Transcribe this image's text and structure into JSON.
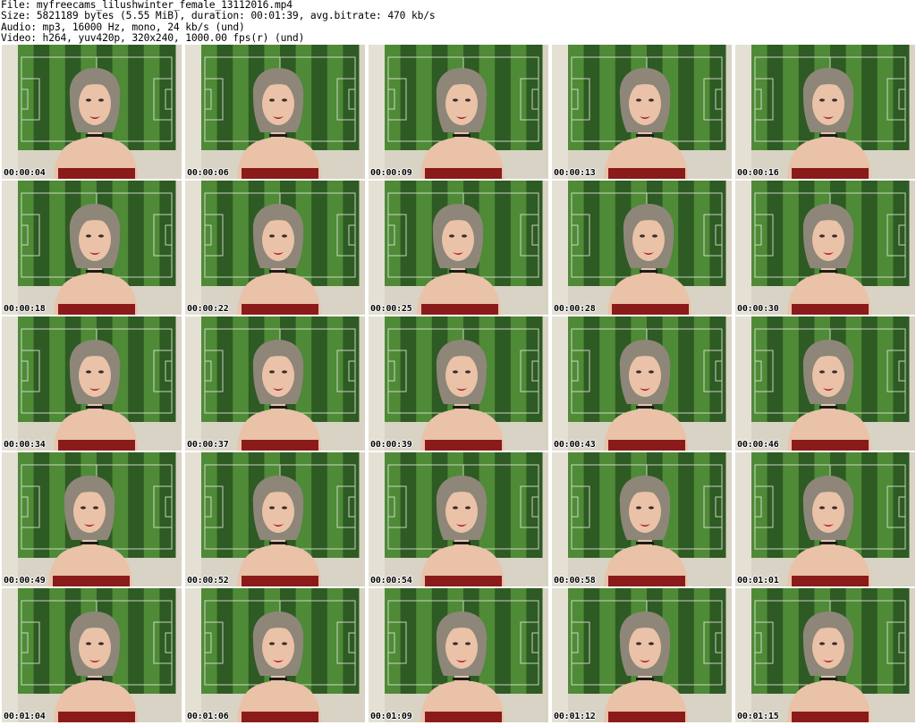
{
  "header": {
    "file_line": "File: myfreecams_lilushwinter_female_13112016.mp4",
    "size_line": "Size: 5821189 bytes (5.55 MiB), duration: 00:01:39, avg.bitrate: 470 kb/s",
    "audio_line": "Audio: mp3, 16000 Hz, mono, 24 kb/s (und)",
    "video_line": "Video: h264, yuv420p, 320x240, 1000.00 fps(r) (und)"
  },
  "frames": [
    "00:00:04",
    "00:00:06",
    "00:00:09",
    "00:00:13",
    "00:00:16",
    "00:00:18",
    "00:00:22",
    "00:00:25",
    "00:00:28",
    "00:00:30",
    "00:00:34",
    "00:00:37",
    "00:00:39",
    "00:00:43",
    "00:00:46",
    "00:00:49",
    "00:00:52",
    "00:00:54",
    "00:00:58",
    "00:01:01",
    "00:01:04",
    "00:01:06",
    "00:01:09",
    "00:01:12",
    "00:01:15"
  ],
  "colors": {
    "wall": "#d8d3c4",
    "field_light": "#4f8a37",
    "field_dark": "#2e5a23",
    "hair": "#8e8678",
    "skin": "#e9c2a8",
    "top": "#8b1a1a",
    "lips": "#b3172a"
  },
  "icons": [
    "video-frame-thumbnail"
  ]
}
